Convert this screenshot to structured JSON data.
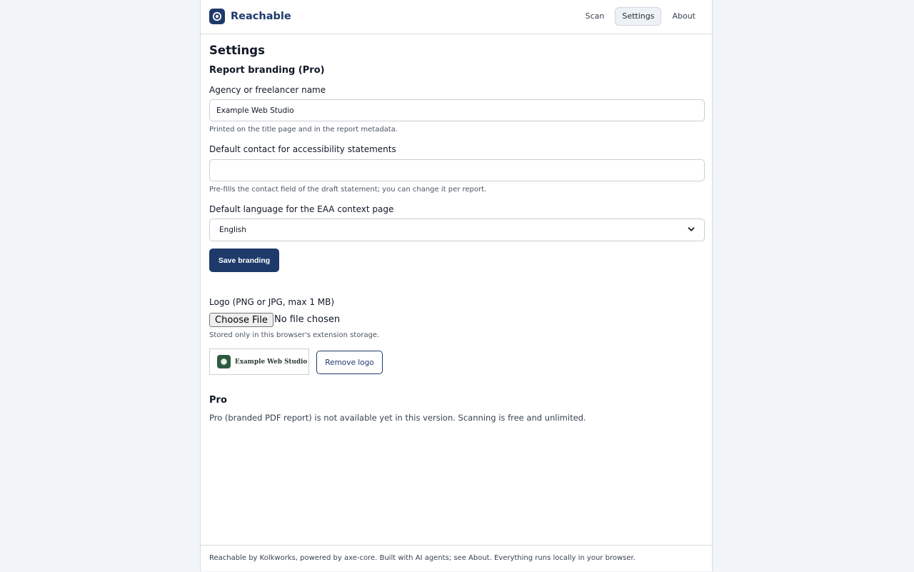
{
  "app": {
    "name": "Reachable"
  },
  "nav": {
    "items": [
      {
        "label": "Scan"
      },
      {
        "label": "Settings"
      },
      {
        "label": "About"
      }
    ]
  },
  "page": {
    "title": "Settings"
  },
  "branding": {
    "heading": "Report branding (Pro)",
    "agency": {
      "label": "Agency or freelancer name",
      "value": "Example Web Studio",
      "hint": "Printed on the title page and in the report metadata."
    },
    "contact": {
      "label": "Default contact for accessibility statements",
      "value": "",
      "hint": "Pre-fills the contact field of the draft statement; you can change it per report."
    },
    "language": {
      "label": "Default language for the EAA context page",
      "selected": "English"
    },
    "save_label": "Save branding"
  },
  "logo": {
    "label": "Logo (PNG or JPG, max 1 MB)",
    "choose_label": "Choose File",
    "file_status": "No file chosen",
    "hint": "Stored only in this browser's extension storage.",
    "preview_text": "Example Web Studio",
    "remove_label": "Remove logo"
  },
  "pro": {
    "heading": "Pro",
    "text": "Pro (branded PDF report) is not available yet in this version. Scanning is free and unlimited."
  },
  "footer": {
    "text": "Reachable by Kolkworks, powered by axe-core. Built with AI agents; see About. Everything runs locally in your browser."
  },
  "colors": {
    "brand": "#1e3a6b",
    "background": "#f1f4f8",
    "logo_mark": "#2f5a3f"
  },
  "icons": {
    "brand": "target-icon",
    "select": "chevron-down-icon",
    "logo": "logo-mark-icon"
  }
}
